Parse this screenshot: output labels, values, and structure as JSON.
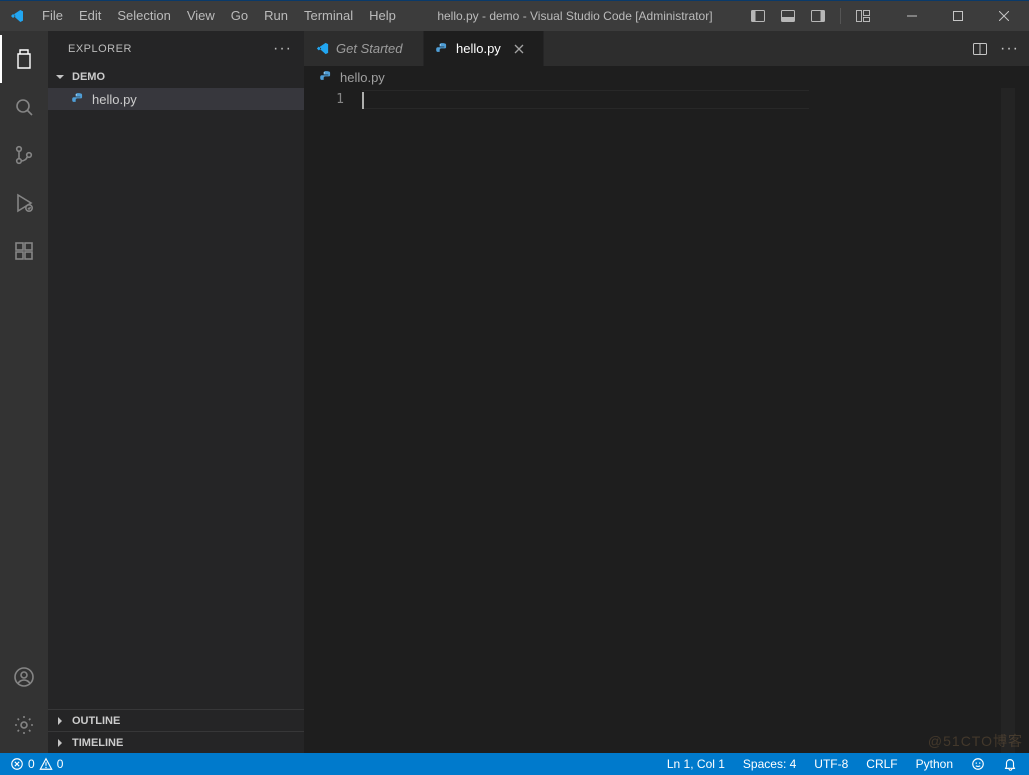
{
  "titlebar": {
    "menus": [
      "File",
      "Edit",
      "Selection",
      "View",
      "Go",
      "Run",
      "Terminal",
      "Help"
    ],
    "title": "hello.py - demo - Visual Studio Code [Administrator]"
  },
  "activity": {
    "top": [
      {
        "name": "explorer-icon",
        "active": true
      },
      {
        "name": "search-icon",
        "active": false
      },
      {
        "name": "source-control-icon",
        "active": false
      },
      {
        "name": "run-debug-icon",
        "active": false
      },
      {
        "name": "extensions-icon",
        "active": false
      }
    ],
    "bottom": [
      {
        "name": "accounts-icon"
      },
      {
        "name": "settings-gear-icon"
      }
    ]
  },
  "sidebar": {
    "title": "EXPLORER",
    "folder": "DEMO",
    "files": [
      {
        "name": "hello.py",
        "icon": "python-file-icon",
        "selected": true
      }
    ],
    "collapsed": [
      "OUTLINE",
      "TIMELINE"
    ]
  },
  "tabs": {
    "items": [
      {
        "label": "Get Started",
        "icon": "vscode-icon",
        "active": false,
        "italic": true,
        "closeable": false
      },
      {
        "label": "hello.py",
        "icon": "python-file-icon",
        "active": true,
        "italic": false,
        "closeable": true
      }
    ]
  },
  "breadcrumbs": {
    "segments": [
      {
        "icon": "python-file-icon",
        "label": "hello.py"
      }
    ]
  },
  "editor": {
    "line_numbers": [
      "1"
    ],
    "lines": [
      ""
    ]
  },
  "statusbar": {
    "left": {
      "errors": "0",
      "warnings": "0"
    },
    "right": {
      "cursor": "Ln 1, Col 1",
      "spaces": "Spaces: 4",
      "encoding": "UTF-8",
      "eol": "CRLF",
      "language": "Python"
    }
  },
  "watermark": "@51CTO博客"
}
